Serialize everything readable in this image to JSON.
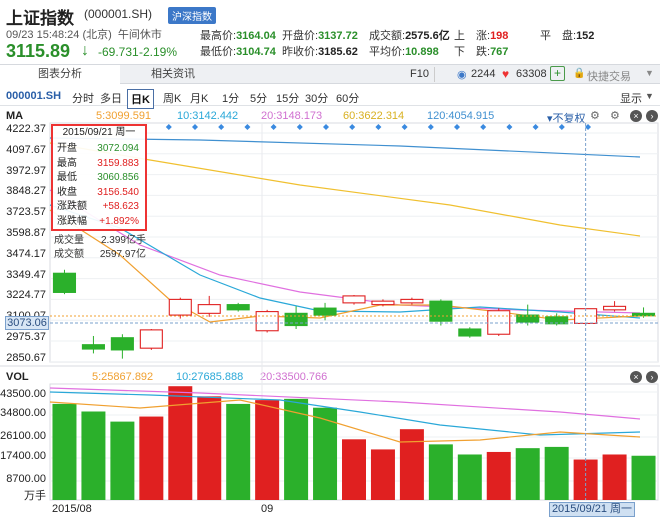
{
  "header": {
    "title": "上证指数",
    "code": "(000001.SH)",
    "badge": "沪深指数",
    "time": "09/23 15:48:24 (北京)",
    "status": "午间休市",
    "price": "3115.89",
    "change": "-69.731",
    "change_pct": "-2.19%",
    "stats": [
      {
        "label": "最高价:",
        "value": "3164.04",
        "color": "g"
      },
      {
        "label": "开盘价:",
        "value": "3137.72",
        "color": "g"
      },
      {
        "label": "成交额:",
        "value": "2575.6亿",
        "color": ""
      },
      {
        "label": "上　涨:",
        "value": "198",
        "color": "r"
      },
      {
        "label": "平　盘:",
        "value": "152",
        "color": ""
      },
      {
        "label": "最低价:",
        "value": "3104.74",
        "color": "g"
      },
      {
        "label": "昨收价:",
        "value": "3185.62",
        "color": ""
      },
      {
        "label": "平均价:",
        "value": "10.898",
        "color": "g"
      },
      {
        "label": "下　跌:",
        "value": "767",
        "color": "g"
      }
    ]
  },
  "tabs": {
    "analysis": "图表分析",
    "news": "相关资讯",
    "f10": "F10",
    "watchers": "2244",
    "likes": "63308",
    "plus": "+",
    "trade": "快捷交易"
  },
  "period_bar": {
    "code": "000001.SH",
    "periods": [
      "分时",
      "多日",
      "日K",
      "周K",
      "月K",
      "1分",
      "5分",
      "15分",
      "30分",
      "60分"
    ],
    "display": "显示"
  },
  "ma_legend": {
    "label": "MA",
    "ma5": "5:3099.591",
    "ma10": "10:3142.442",
    "ma20": "20:3148.173",
    "ma60": "60:3622.314",
    "ma120": "120:4054.915",
    "adjust": "不复权"
  },
  "price_axis": [
    "4222.37",
    "4097.67",
    "3972.97",
    "3848.27",
    "3723.57",
    "3598.87",
    "3474.17",
    "3349.47",
    "3224.77",
    "3100.07",
    "2975.37",
    "2850.67"
  ],
  "crosshair_value": "3073.06",
  "tooltip": {
    "date": "2015/09/21 周一",
    "rows": [
      {
        "k": "开盘",
        "v": "3072.094",
        "c": "g"
      },
      {
        "k": "最高",
        "v": "3159.883",
        "c": "r"
      },
      {
        "k": "最低",
        "v": "3060.856",
        "c": "g"
      },
      {
        "k": "收盘",
        "v": "3156.540",
        "c": "r"
      },
      {
        "k": "涨跌额",
        "v": "+58.623",
        "c": "r"
      },
      {
        "k": "涨跌幅",
        "v": "+1.892%",
        "c": "r"
      }
    ],
    "plain": [
      {
        "k": "成交量",
        "v": "2.399亿手"
      },
      {
        "k": "成交额",
        "v": "2597.97亿"
      }
    ]
  },
  "vol_legend": {
    "label": "VOL",
    "ma5": "5:25867.892",
    "ma10": "10:27685.888",
    "ma20": "20:33500.766"
  },
  "vol_axis": [
    "43500.00",
    "34800.00",
    "26100.00",
    "17400.00",
    "8700.00",
    "万手"
  ],
  "date_axis": {
    "left": "2015/08",
    "mid": "09",
    "crosshair": "2015/09/21 周一"
  },
  "colors": {
    "up": "#e02020",
    "down": "#2bb02b",
    "ma5": "#f0a030",
    "ma10": "#2aa8d8",
    "ma20": "#e070e0",
    "ma60": "#f0c030",
    "ma120": "#4090d0"
  },
  "chart_data": {
    "type": "candlestick",
    "title": "上证指数 日K",
    "candles": [
      {
        "open": 3360,
        "close": 3250,
        "high": 3380,
        "low": 3240
      },
      {
        "open": 2950,
        "close": 2925,
        "high": 3000,
        "low": 2900
      },
      {
        "open": 2990,
        "close": 2920,
        "high": 3010,
        "low": 2870
      },
      {
        "open": 2930,
        "close": 3035,
        "high": 3040,
        "low": 2920
      },
      {
        "open": 3120,
        "close": 3210,
        "high": 3220,
        "low": 3100
      },
      {
        "open": 3130,
        "close": 3180,
        "high": 3230,
        "low": 3110
      },
      {
        "open": 3180,
        "close": 3150,
        "high": 3190,
        "low": 3140
      },
      {
        "open": 3030,
        "close": 3140,
        "high": 3150,
        "low": 3020
      },
      {
        "open": 3130,
        "close": 3060,
        "high": 3170,
        "low": 3040
      },
      {
        "open": 3160,
        "close": 3120,
        "high": 3190,
        "low": 3090
      },
      {
        "open": 3190,
        "close": 3230,
        "high": 3235,
        "low": 3180
      },
      {
        "open": 3180,
        "close": 3200,
        "high": 3210,
        "low": 3170
      },
      {
        "open": 3190,
        "close": 3210,
        "high": 3220,
        "low": 3180
      },
      {
        "open": 3200,
        "close": 3085,
        "high": 3210,
        "low": 3060
      },
      {
        "open": 3040,
        "close": 3000,
        "high": 3050,
        "low": 2990
      },
      {
        "open": 3010,
        "close": 3145,
        "high": 3160,
        "low": 3000
      },
      {
        "open": 3120,
        "close": 3080,
        "high": 3180,
        "low": 3060
      },
      {
        "open": 3110,
        "close": 3070,
        "high": 3130,
        "low": 3060
      },
      {
        "open": 3072.094,
        "close": 3156.54,
        "high": 3159.883,
        "low": 3060.856
      },
      {
        "open": 3150,
        "close": 3170,
        "high": 3200,
        "low": 3140
      },
      {
        "open": 3130,
        "close": 3115.89,
        "high": 3164.04,
        "low": 3104.74
      }
    ],
    "volumes": [
      38000,
      35000,
      31000,
      33000,
      45000,
      41000,
      38000,
      39500,
      40000,
      36500,
      24000,
      20000,
      28000,
      22000,
      18000,
      19000,
      20500,
      21000,
      16000,
      18000,
      17500
    ],
    "ylim": [
      2850.67,
      4222.37
    ],
    "vol_ylim": [
      0,
      43500
    ]
  }
}
